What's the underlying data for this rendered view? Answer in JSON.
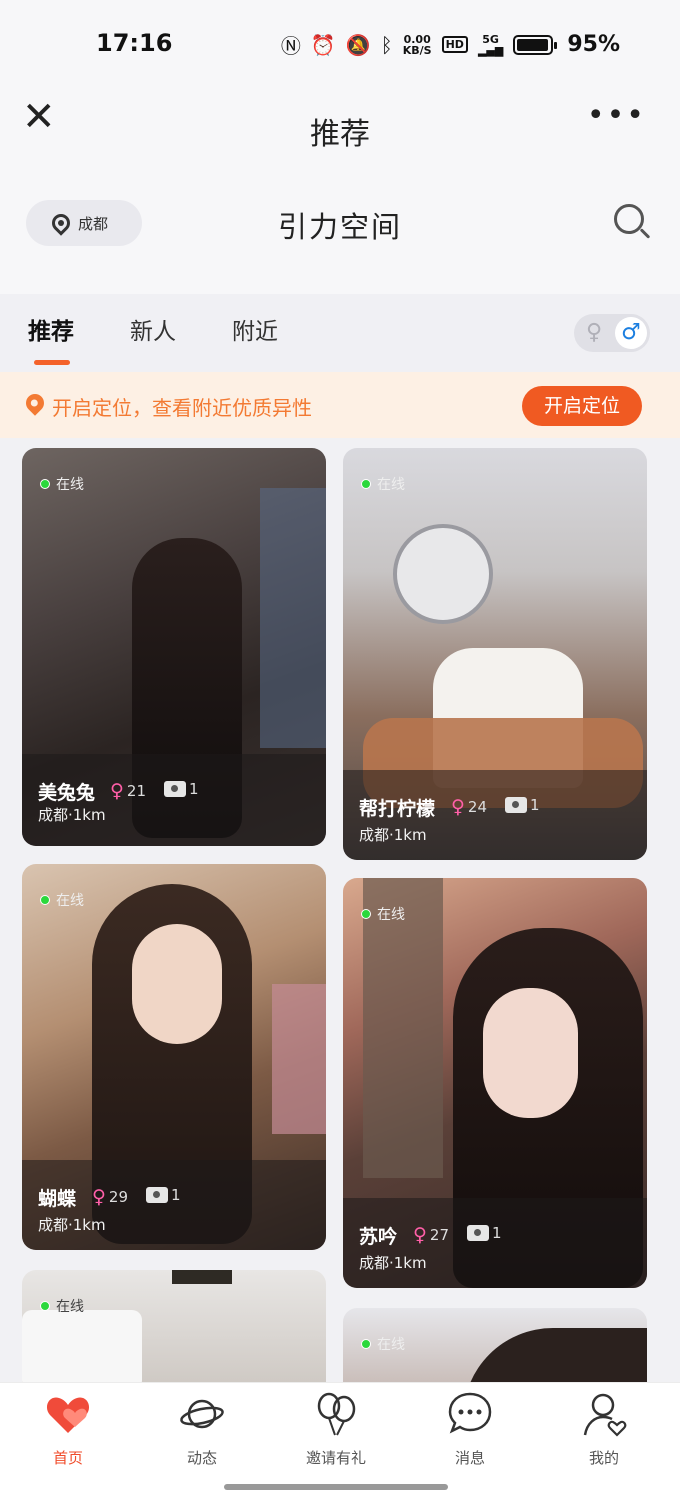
{
  "status_bar": {
    "time": "17:16",
    "net_speed_value": "0.00",
    "net_speed_unit": "KB/S",
    "hd_label": "HD",
    "net_label": "5G",
    "battery_level": 0.95,
    "battery_pct": "95%"
  },
  "title_bar": {
    "title": "推荐",
    "close_icon": "close-icon",
    "more_icon": "more-icon"
  },
  "header": {
    "city": "成都",
    "brand": "引力空间"
  },
  "tabs": [
    {
      "label": "推荐",
      "active": true
    },
    {
      "label": "新人",
      "active": false
    },
    {
      "label": "附近",
      "active": false
    }
  ],
  "gender_filter": {
    "female_symbol": "♀",
    "male_symbol": "♂",
    "selected": "male"
  },
  "location_banner": {
    "message": "开启定位，查看附近优质异性",
    "button": "开启定位"
  },
  "cards": [
    {
      "name": "美兔兔",
      "age": "21",
      "photos": "1",
      "location": "成都·1km",
      "status": "在线"
    },
    {
      "name": "帮打柠檬",
      "age": "24",
      "photos": "1",
      "location": "成都·1km",
      "status": "在线"
    },
    {
      "name": "蝴蝶",
      "age": "29",
      "photos": "1",
      "location": "成都·1km",
      "status": "在线"
    },
    {
      "name": "苏吟",
      "age": "27",
      "photos": "1",
      "location": "成都·1km",
      "status": "在线"
    },
    {
      "status": "在线"
    },
    {
      "status": "在线"
    }
  ],
  "bottom_nav": [
    {
      "label": "首页",
      "icon": "home-hearts-icon",
      "active": true
    },
    {
      "label": "动态",
      "icon": "planet-icon",
      "active": false
    },
    {
      "label": "邀请有礼",
      "icon": "balloons-icon",
      "active": false
    },
    {
      "label": "消息",
      "icon": "chat-bubble-icon",
      "active": false
    },
    {
      "label": "我的",
      "icon": "profile-heart-icon",
      "active": false
    }
  ],
  "colors": {
    "accent": "#f05a22",
    "online": "#2bd83c",
    "female": "#ff5fa8",
    "male": "#1c7fe0"
  }
}
